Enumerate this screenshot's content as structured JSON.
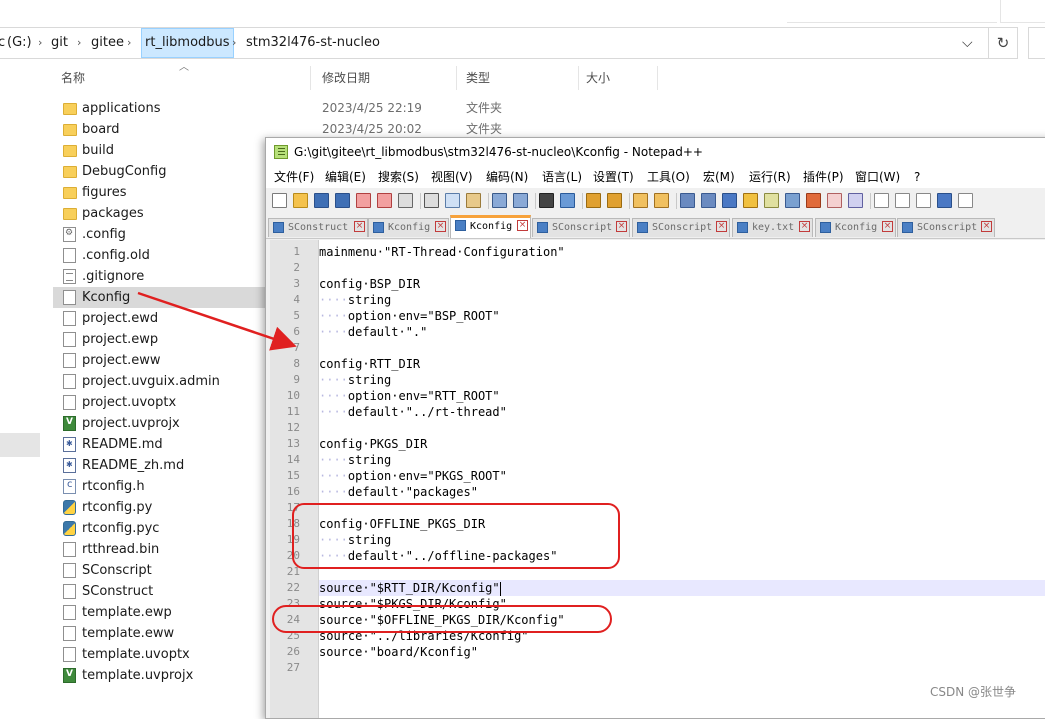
{
  "explorer": {
    "breadcrumbs": [
      "(G:)",
      "git",
      "gitee",
      "rt_libmodbus",
      "stm32l476-st-nucleo"
    ],
    "drive_fragment": "c",
    "columns": {
      "name": "名称",
      "modified": "修改日期",
      "type": "类型",
      "size": "大小"
    },
    "files": [
      {
        "name": "applications",
        "icon": "folder-icon",
        "modified": "2023/4/25 22:19",
        "type": "文件夹"
      },
      {
        "name": "board",
        "icon": "folder-icon",
        "modified": "2023/4/25 20:02",
        "type": "文件夹"
      },
      {
        "name": "build",
        "icon": "folder-icon"
      },
      {
        "name": "DebugConfig",
        "icon": "folder-icon"
      },
      {
        "name": "figures",
        "icon": "folder-icon"
      },
      {
        "name": "packages",
        "icon": "folder-icon"
      },
      {
        "name": ".config",
        "icon": "config-file-icon"
      },
      {
        "name": ".config.old",
        "icon": "file-icon"
      },
      {
        "name": ".gitignore",
        "icon": "text-file-icon"
      },
      {
        "name": "Kconfig",
        "icon": "file-icon",
        "selected": true
      },
      {
        "name": "project.ewd",
        "icon": "file-icon"
      },
      {
        "name": "project.ewp",
        "icon": "file-icon"
      },
      {
        "name": "project.eww",
        "icon": "file-icon"
      },
      {
        "name": "project.uvguix.admin",
        "icon": "file-icon"
      },
      {
        "name": "project.uvoptx",
        "icon": "file-icon"
      },
      {
        "name": "project.uvprojx",
        "icon": "keil-project-icon"
      },
      {
        "name": "README.md",
        "icon": "markdown-file-icon"
      },
      {
        "name": "README_zh.md",
        "icon": "markdown-file-icon"
      },
      {
        "name": "rtconfig.h",
        "icon": "c-header-file-icon"
      },
      {
        "name": "rtconfig.py",
        "icon": "python-file-icon"
      },
      {
        "name": "rtconfig.pyc",
        "icon": "python-file-icon"
      },
      {
        "name": "rtthread.bin",
        "icon": "file-icon"
      },
      {
        "name": "SConscript",
        "icon": "file-icon"
      },
      {
        "name": "SConstruct",
        "icon": "file-icon"
      },
      {
        "name": "template.ewp",
        "icon": "file-icon"
      },
      {
        "name": "template.eww",
        "icon": "file-icon"
      },
      {
        "name": "template.uvoptx",
        "icon": "file-icon"
      },
      {
        "name": "template.uvprojx",
        "icon": "keil-project-icon"
      }
    ]
  },
  "notepad": {
    "title": "G:\\git\\gitee\\rt_libmodbus\\stm32l476-st-nucleo\\Kconfig - Notepad++",
    "menu": [
      "文件(F)",
      "编辑(E)",
      "搜索(S)",
      "视图(V)",
      "编码(N)",
      "语言(L)",
      "设置(T)",
      "工具(O)",
      "宏(M)",
      "运行(R)",
      "插件(P)",
      "窗口(W)",
      "?"
    ],
    "tabs": [
      {
        "label": "SConstruct",
        "active": false
      },
      {
        "label": "Kconfig",
        "active": false
      },
      {
        "label": "Kconfig",
        "active": true
      },
      {
        "label": "SConscript",
        "active": false
      },
      {
        "label": "SConscript",
        "active": false
      },
      {
        "label": "key.txt",
        "active": false
      },
      {
        "label": "Kconfig",
        "active": false
      },
      {
        "label": "SConscript",
        "active": false
      }
    ],
    "lines": [
      {
        "n": "1",
        "indent": 0,
        "text": "mainmenu \"RT-Thread Configuration\""
      },
      {
        "n": "2",
        "indent": 0,
        "text": ""
      },
      {
        "n": "3",
        "indent": 0,
        "text": "config BSP_DIR"
      },
      {
        "n": "4",
        "indent": 1,
        "text": "string"
      },
      {
        "n": "5",
        "indent": 1,
        "text": "option env=\"BSP_ROOT\""
      },
      {
        "n": "6",
        "indent": 1,
        "text": "default \".\""
      },
      {
        "n": "7",
        "indent": 0,
        "text": ""
      },
      {
        "n": "8",
        "indent": 0,
        "text": "config RTT_DIR"
      },
      {
        "n": "9",
        "indent": 1,
        "text": "string"
      },
      {
        "n": "10",
        "indent": 1,
        "text": "option env=\"RTT_ROOT\""
      },
      {
        "n": "11",
        "indent": 1,
        "text": "default \"../rt-thread\""
      },
      {
        "n": "12",
        "indent": 0,
        "text": ""
      },
      {
        "n": "13",
        "indent": 0,
        "text": "config PKGS_DIR"
      },
      {
        "n": "14",
        "indent": 1,
        "text": "string"
      },
      {
        "n": "15",
        "indent": 1,
        "text": "option env=\"PKGS_ROOT\""
      },
      {
        "n": "16",
        "indent": 1,
        "text": "default \"packages\""
      },
      {
        "n": "17",
        "indent": 0,
        "text": ""
      },
      {
        "n": "18",
        "indent": 0,
        "text": "config OFFLINE_PKGS_DIR"
      },
      {
        "n": "19",
        "indent": 1,
        "text": "string"
      },
      {
        "n": "20",
        "indent": 1,
        "text": "default \"../offline-packages\""
      },
      {
        "n": "21",
        "indent": 0,
        "text": ""
      },
      {
        "n": "22",
        "indent": 0,
        "text": "source \"$RTT_DIR/Kconfig\"",
        "current": true
      },
      {
        "n": "23",
        "indent": 0,
        "text": "source \"$PKGS_DIR/Kconfig\""
      },
      {
        "n": "24",
        "indent": 0,
        "text": "source \"$OFFLINE_PKGS_DIR/Kconfig\""
      },
      {
        "n": "25",
        "indent": 0,
        "text": "source \"../libraries/Kconfig\""
      },
      {
        "n": "26",
        "indent": 0,
        "text": "source \"board/Kconfig\""
      },
      {
        "n": "27",
        "indent": 0,
        "text": ""
      }
    ]
  },
  "watermark": "CSDN @张世争",
  "colors": {
    "annotation": "#e02020",
    "tab_accent": "#f7a23b",
    "selection": "#cce8ff"
  }
}
